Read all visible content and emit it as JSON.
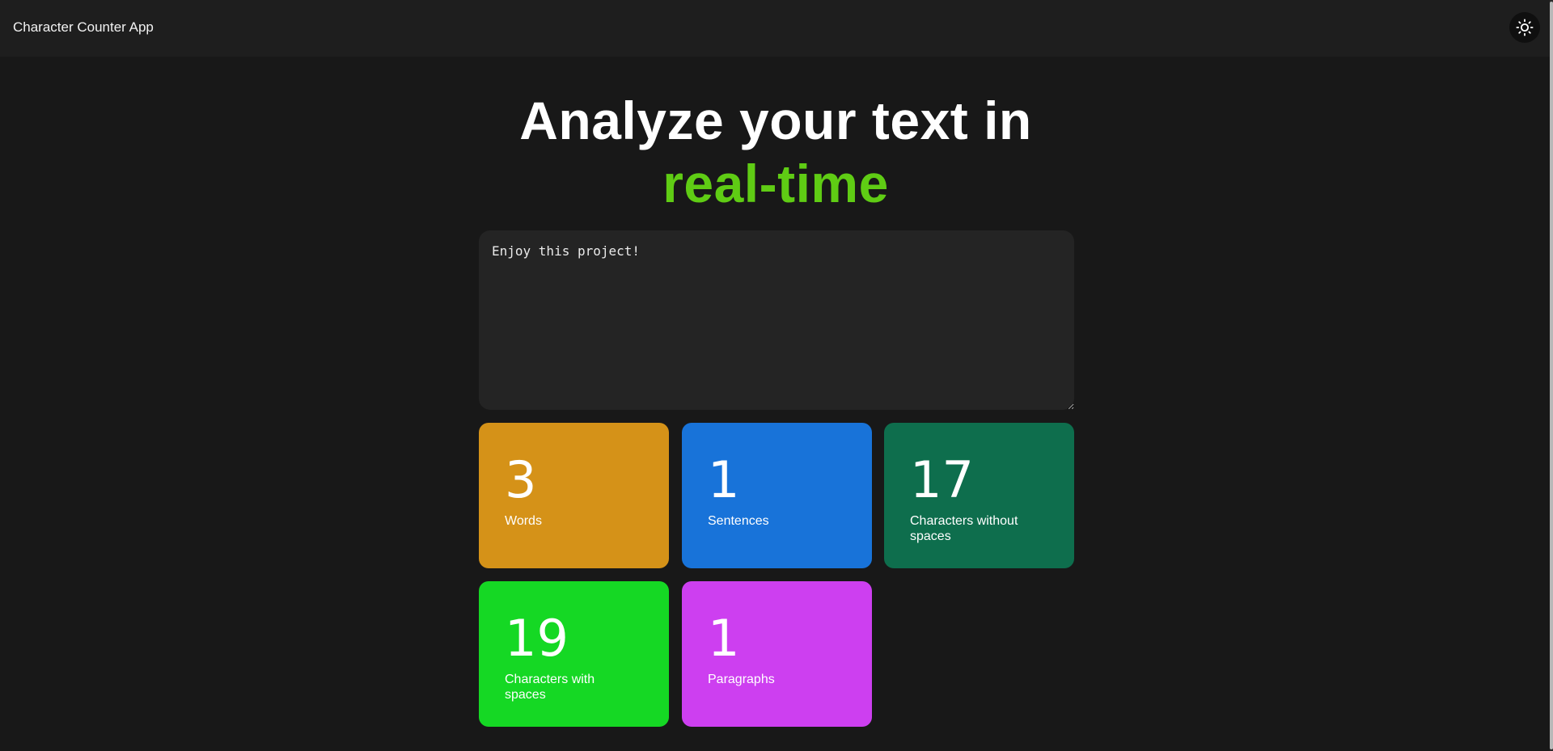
{
  "header": {
    "app_title": "Character Counter App",
    "theme_icon": "sun-icon"
  },
  "hero": {
    "line1": "Analyze your text in",
    "line2": "real-time",
    "accent_color": "#5fcc14"
  },
  "editor": {
    "value": "Enjoy this project!",
    "placeholder": ""
  },
  "stats": [
    {
      "value": "3",
      "label": "Words",
      "color": "#d59218"
    },
    {
      "value": "1",
      "label": "Sentences",
      "color": "#1873d9"
    },
    {
      "value": "17",
      "label": "Characters without spaces",
      "color": "#0e6e4d"
    },
    {
      "value": "19",
      "label": "Characters with spaces",
      "color": "#15d824"
    },
    {
      "value": "1",
      "label": "Paragraphs",
      "color": "#cd3ff0"
    }
  ]
}
